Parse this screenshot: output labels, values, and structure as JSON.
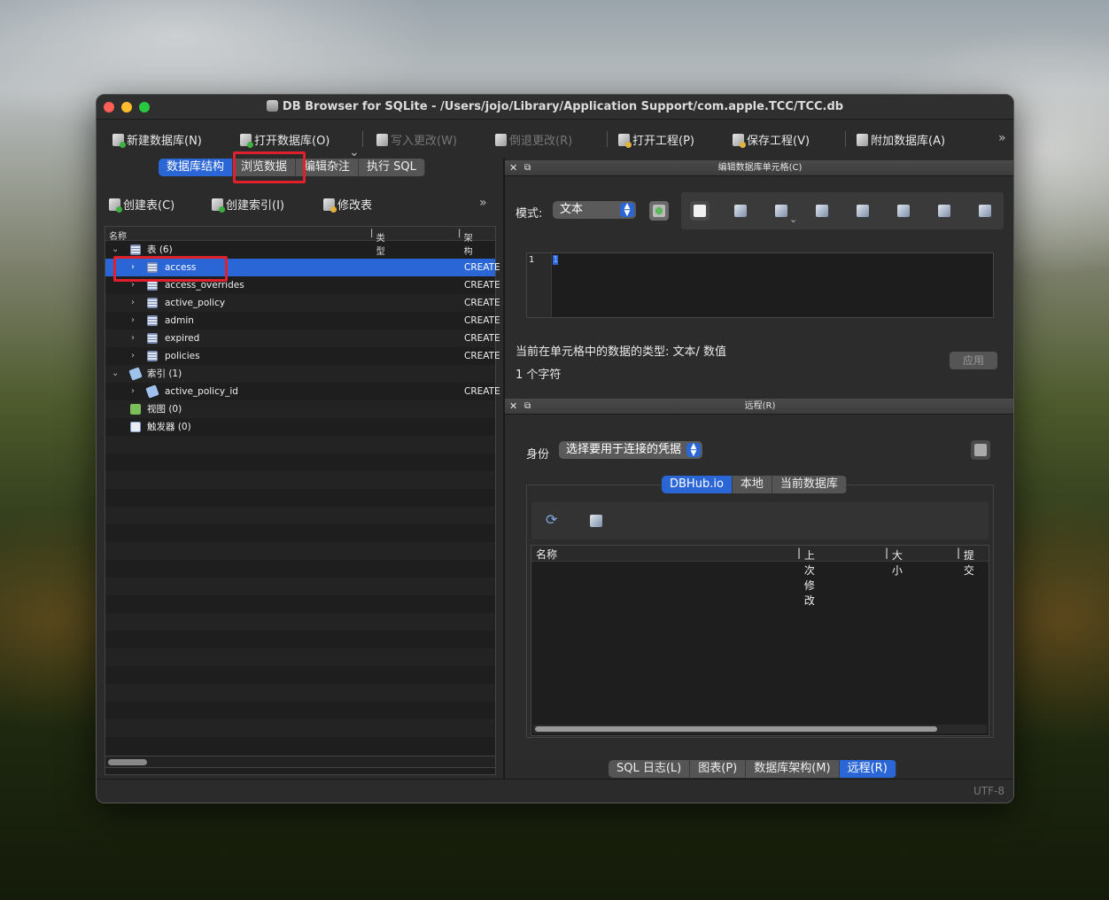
{
  "window": {
    "title": "DB Browser for SQLite - /Users/jojo/Library/Application Support/com.apple.TCC/TCC.db"
  },
  "toolbar": {
    "new_db": "新建数据库(N)",
    "open_db": "打开数据库(O)",
    "write_changes": "写入更改(W)",
    "revert_changes": "倒退更改(R)",
    "open_project": "打开工程(P)",
    "save_project": "保存工程(V)",
    "attach_db": "附加数据库(A)"
  },
  "main_tabs": [
    "数据库结构",
    "浏览数据",
    "编辑杂注",
    "执行 SQL"
  ],
  "structure_actions": {
    "create_table": "创建表(C)",
    "create_index": "创建索引(I)",
    "modify_table": "修改表"
  },
  "tree": {
    "headers": {
      "name": "名称",
      "type": "类型",
      "schema": "架构"
    },
    "rows": [
      {
        "label": "表 (6)",
        "schema": ""
      },
      {
        "label": "access",
        "schema": "CREATE"
      },
      {
        "label": "access_overrides",
        "schema": "CREATE"
      },
      {
        "label": "active_policy",
        "schema": "CREATE"
      },
      {
        "label": "admin",
        "schema": "CREATE"
      },
      {
        "label": "expired",
        "schema": "CREATE"
      },
      {
        "label": "policies",
        "schema": "CREATE"
      },
      {
        "label": "索引 (1)",
        "schema": ""
      },
      {
        "label": "active_policy_id",
        "schema": "CREATE"
      },
      {
        "label": "视图 (0)",
        "schema": ""
      },
      {
        "label": "触发器 (0)",
        "schema": ""
      }
    ]
  },
  "edit_cell": {
    "title": "编辑数据库单元格(C)",
    "mode_label": "模式:",
    "mode_value": "文本",
    "line_number": "1",
    "cursor_text": "1",
    "type_info": "当前在单元格中的数据的类型: 文本/ 数值",
    "char_count": "1 个字符",
    "apply": "应用"
  },
  "remote": {
    "title": "远程(R)",
    "identity_label": "身份",
    "identity_value": "选择要用于连接的凭据",
    "tabs": [
      "DBHub.io",
      "本地",
      "当前数据库"
    ],
    "columns": [
      "名称",
      "上次修改",
      "大小",
      "提交"
    ]
  },
  "bottom_tabs": [
    "SQL 日志(L)",
    "图表(P)",
    "数据库架构(M)",
    "远程(R)"
  ],
  "status": {
    "encoding": "UTF-8"
  },
  "colors": {
    "accent": "#2a66d6",
    "highlight": "#e0202c"
  }
}
